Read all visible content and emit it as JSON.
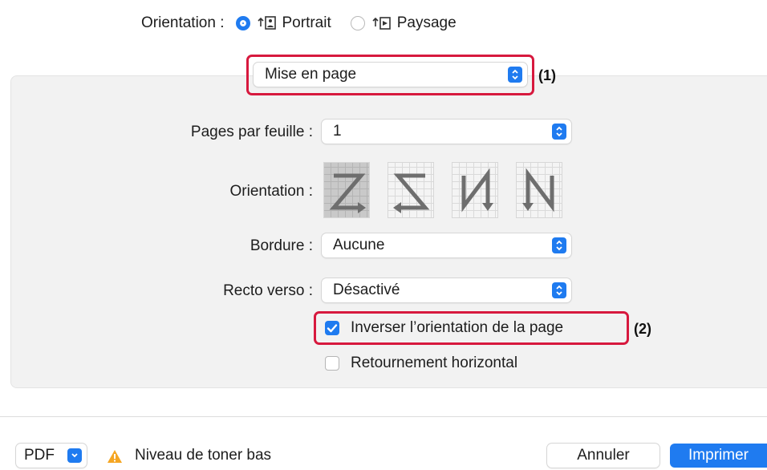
{
  "top": {
    "label": "Orientation :",
    "option_portrait": "Portrait",
    "option_landscape": "Paysage",
    "selected": "Portrait"
  },
  "section_popup": {
    "value": "Mise en page",
    "callout": "(1)"
  },
  "layout": {
    "pages_per_sheet_label": "Pages par feuille :",
    "pages_per_sheet_value": "1",
    "orientation_label": "Orientation :",
    "orientation_options": [
      "z-left-to-right",
      "z-right-to-left",
      "n-reverse",
      "n-top-to-bottom"
    ],
    "orientation_selected": 0,
    "border_label": "Bordure :",
    "border_value": "Aucune",
    "duplex_label": "Recto verso :",
    "duplex_value": "Désactivé",
    "reverse_orientation_label": "Inverser l’orientation de la page",
    "reverse_orientation_checked": true,
    "reverse_callout": "(2)",
    "flip_horizontal_label": "Retournement horizontal",
    "flip_horizontal_checked": false
  },
  "bottom": {
    "pdf_label": "PDF",
    "warning_text": "Niveau de toner bas",
    "cancel_label": "Annuler",
    "print_label": "Imprimer"
  },
  "colors": {
    "accent": "#1f7bf0",
    "callout": "#d7193e",
    "warning": "#f5a623"
  }
}
